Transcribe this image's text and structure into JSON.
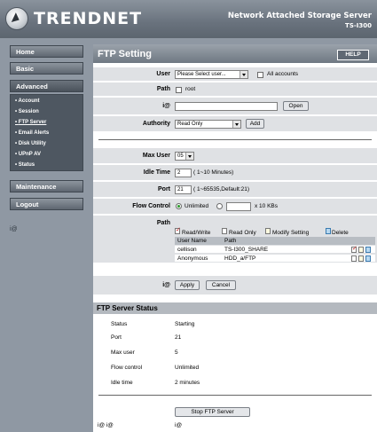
{
  "header": {
    "brand": "TRENDNET",
    "product_name": "Network Attached Storage Server",
    "model": "TS-I300"
  },
  "sidebar": {
    "home": "Home",
    "basic": "Basic",
    "advanced": "Advanced",
    "sub_items": [
      "Account",
      "Session",
      "FTP Server",
      "Email Alerts",
      "Disk Utility",
      "UPnP AV",
      "Status"
    ],
    "maintenance": "Maintenance",
    "logout": "Logout",
    "broken_img": "i@"
  },
  "main": {
    "title": "FTP Setting",
    "help": "HELP",
    "user_label": "User",
    "user_select": "Please Select user...",
    "all_accounts": "All accounts",
    "path_label": "Path",
    "root": "root",
    "broken_img": "i@",
    "open": "Open",
    "authority_label": "Authority",
    "authority_value": "Read Only",
    "add": "Add",
    "max_user_label": "Max User",
    "max_user_value": "05",
    "idle_time_label": "Idle Time",
    "idle_time_value": "2",
    "idle_time_hint": "( 1~10 Minutes)",
    "port_label": "Port",
    "port_value": "21",
    "port_hint": "( 1~65535,Default:21)",
    "flow_control_label": "Flow Control",
    "unlimited": "Unlimited",
    "flow_unit": "x 10 KBs",
    "path2_label": "Path",
    "legend": {
      "read_write": "Read/Write",
      "read_only": "Read Only",
      "modify": "Modify Setting",
      "delete": "Delete"
    },
    "table": {
      "headers": [
        "User Name",
        "Path"
      ],
      "rows": [
        {
          "user": "cellison",
          "path": "TS-I300_SHARE"
        },
        {
          "user": "Anonymous",
          "path": "HDD_a/FTP"
        }
      ]
    },
    "apply": "Apply",
    "cancel": "Cancel"
  },
  "status": {
    "title": "FTP Server Status",
    "rows": [
      {
        "label": "Status",
        "value": "Starting"
      },
      {
        "label": "Port",
        "value": "21"
      },
      {
        "label": "Max user",
        "value": "5"
      },
      {
        "label": "Flow control",
        "value": "Unlimited"
      },
      {
        "label": "Idle time",
        "value": "2 minutes"
      }
    ],
    "stop_button": "Stop FTP Server",
    "footer_left": "i@ i@",
    "footer_right": "i@"
  }
}
